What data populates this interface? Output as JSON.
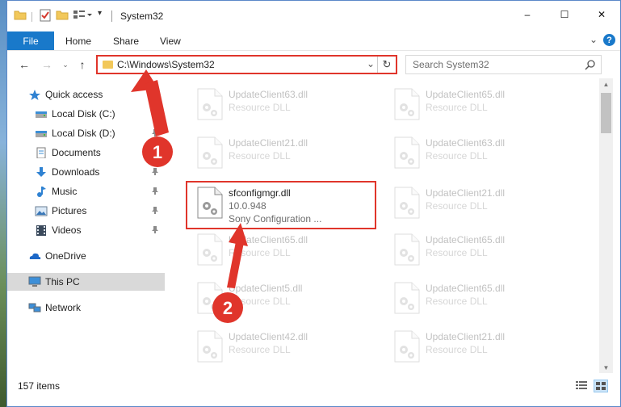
{
  "window": {
    "title": "System32",
    "controls": {
      "minimize": "–",
      "maximize": "☐",
      "close": "✕"
    }
  },
  "ribbon": {
    "tabs": [
      "File",
      "Home",
      "Share",
      "View"
    ],
    "collapse": "⌄",
    "help": "?"
  },
  "address": {
    "path": "C:\\Windows\\System32",
    "dropdown": "⌄",
    "refresh": "↻"
  },
  "search": {
    "placeholder": "Search System32"
  },
  "sidebar": {
    "items": [
      {
        "label": "Quick access",
        "icon": "star-icon",
        "pinned": false
      },
      {
        "label": "Local Disk (C:)",
        "icon": "drive-icon",
        "pinned": true
      },
      {
        "label": "Local Disk (D:)",
        "icon": "drive-icon",
        "pinned": true
      },
      {
        "label": "Documents",
        "icon": "documents-icon",
        "pinned": true
      },
      {
        "label": "Downloads",
        "icon": "downloads-icon",
        "pinned": true
      },
      {
        "label": "Music",
        "icon": "music-icon",
        "pinned": true
      },
      {
        "label": "Pictures",
        "icon": "pictures-icon",
        "pinned": true
      },
      {
        "label": "Videos",
        "icon": "videos-icon",
        "pinned": true
      },
      {
        "label": "OneDrive",
        "icon": "onedrive-icon",
        "pinned": false
      },
      {
        "label": "This PC",
        "icon": "computer-icon",
        "pinned": false,
        "selected": true
      },
      {
        "label": "Network",
        "icon": "network-icon",
        "pinned": false
      }
    ]
  },
  "files": [
    {
      "name": "UpdateClient63.dll",
      "type": "Resource DLL"
    },
    {
      "name": "UpdateClient65.dll",
      "type": "Resource DLL"
    },
    {
      "name": "UpdateClient21.dll",
      "type": "Resource DLL"
    },
    {
      "name": "UpdateClient63.dll",
      "type": "Resource DLL"
    },
    {
      "name": "sfconfigmgr.dll",
      "version": "10.0.948",
      "type": "Sony Configuration ...",
      "highlighted": true
    },
    {
      "name": "UpdateClient21.dll",
      "type": "Resource DLL"
    },
    {
      "name": "UpdateClient65.dll",
      "type": "Resource DLL"
    },
    {
      "name": "UpdateClient65.dll",
      "type": "Resource DLL"
    },
    {
      "name": "UpdateClient5.dll",
      "type": "Resource DLL"
    },
    {
      "name": "UpdateClient65.dll",
      "type": "Resource DLL"
    },
    {
      "name": "UpdateClient42.dll",
      "type": "Resource DLL"
    },
    {
      "name": "UpdateClient21.dll",
      "type": "Resource DLL"
    }
  ],
  "status": {
    "item_count": "157 items"
  },
  "annotations": {
    "step1": "1",
    "step2": "2",
    "color": "#e0352b"
  }
}
